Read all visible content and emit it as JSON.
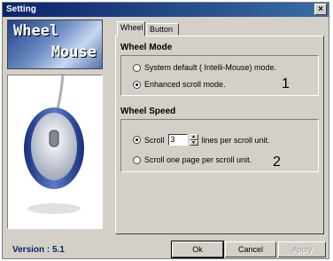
{
  "window": {
    "title": "Setting",
    "close_glyph": "×"
  },
  "banner": {
    "line1": "Wheel",
    "line2": "Mouse"
  },
  "version": "Version : 5.1",
  "tabs": [
    {
      "label": "Wheel",
      "active": true
    },
    {
      "label": "Button",
      "active": false
    }
  ],
  "wheel_mode": {
    "title": "Wheel Mode",
    "options": [
      {
        "label": "System default ( Intelli-Mouse) mode.",
        "selected": false
      },
      {
        "label": "Enhanced scroll mode.",
        "selected": true
      }
    ],
    "marker": "1"
  },
  "wheel_speed": {
    "title": "Wheel Speed",
    "scroll_label": "Scroll",
    "lines_value": "3",
    "lines_suffix": "lines per scroll unit.",
    "page_label": "Scroll one page per scroll unit.",
    "selected": "scroll_lines",
    "marker": "2"
  },
  "buttons": {
    "ok": "Ok",
    "cancel": "Cancel",
    "apply": "Apply"
  },
  "colors": {
    "titlebar": "#0a246a",
    "version_text": "#0a246a",
    "face": "#d4d0c8"
  },
  "icons": {
    "spin_up": "spin-up-icon",
    "spin_down": "spin-down-icon",
    "mouse": "mouse-illustration"
  }
}
